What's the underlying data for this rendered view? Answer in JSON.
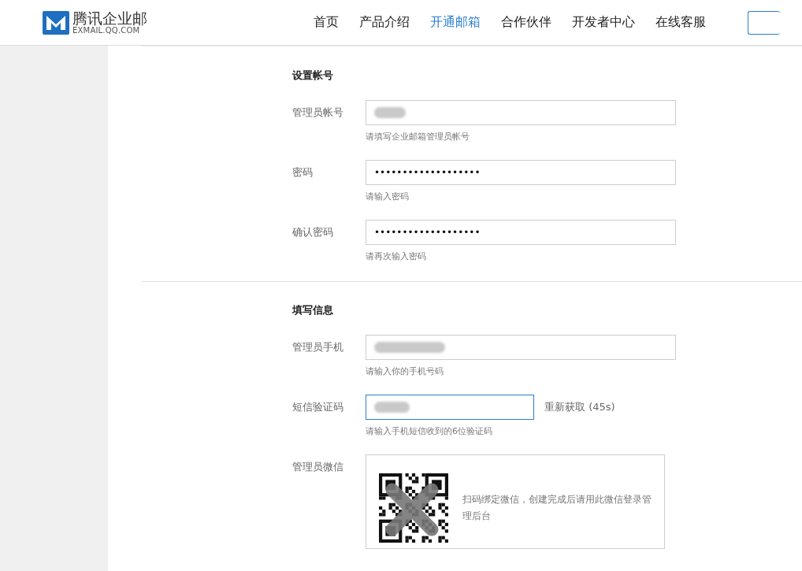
{
  "header": {
    "logo_name": "腾讯企业邮",
    "logo_domain": "EXMAIL.QQ.COM",
    "nav": [
      {
        "label": "首页",
        "selected": false
      },
      {
        "label": "产品介绍",
        "selected": false
      },
      {
        "label": "开通邮箱",
        "selected": true
      },
      {
        "label": "合作伙伴",
        "selected": false
      },
      {
        "label": "开发者中心",
        "selected": false
      },
      {
        "label": "在线客服",
        "selected": false
      }
    ]
  },
  "sections": [
    {
      "title": "设置帐号",
      "fields": [
        {
          "kind": "redacted",
          "label": "管理员帐号",
          "hint": "请填写企业邮箱管理员帐号"
        },
        {
          "kind": "password",
          "label": "密码",
          "value": "•••••••••••••••••••",
          "hint": "请输入密码"
        },
        {
          "kind": "password",
          "label": "确认密码",
          "value": "•••••••••••••••••••",
          "hint": "请再次输入密码"
        }
      ]
    },
    {
      "title": "填写信息",
      "fields": [
        {
          "kind": "redacted",
          "label": "管理员手机",
          "hint": "请输入你的手机号码"
        },
        {
          "kind": "code",
          "label": "短信验证码",
          "focused": true,
          "resend": "重新获取 (45s)",
          "hint": "请输入手机短信收到的6位验证码"
        },
        {
          "kind": "qr",
          "label": "管理员微信",
          "text": "扫码绑定微信，创建完成后请用此微信登录管理后台"
        }
      ]
    }
  ]
}
